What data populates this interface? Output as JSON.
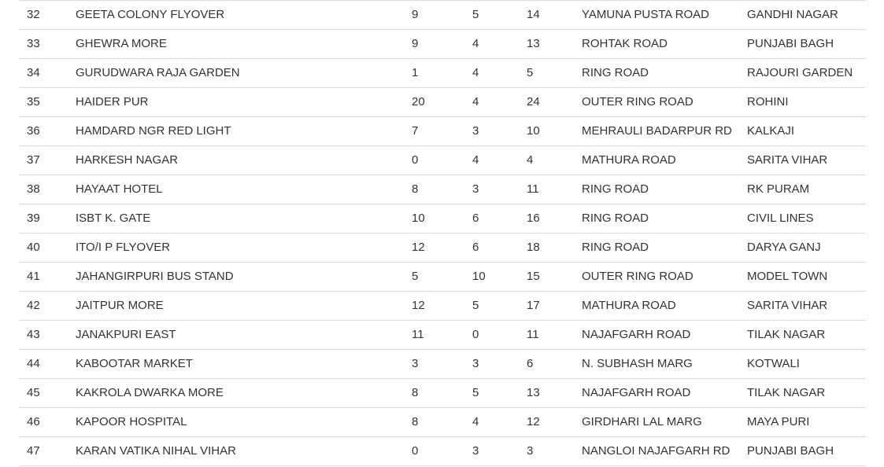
{
  "table": {
    "rows": [
      {
        "no": "32",
        "name": "GEETA COLONY FLYOVER",
        "a": "9",
        "b": "5",
        "c": "14",
        "road": "YAMUNA PUSTA ROAD",
        "area": "GANDHI NAGAR"
      },
      {
        "no": "33",
        "name": "GHEWRA MORE",
        "a": "9",
        "b": "4",
        "c": "13",
        "road": "ROHTAK ROAD",
        "area": "PUNJABI BAGH"
      },
      {
        "no": "34",
        "name": "GURUDWARA RAJA GARDEN",
        "a": "1",
        "b": "4",
        "c": "5",
        "road": "RING ROAD",
        "area": "RAJOURI GARDEN"
      },
      {
        "no": "35",
        "name": "HAIDER PUR",
        "a": "20",
        "b": "4",
        "c": "24",
        "road": "OUTER RING ROAD",
        "area": "ROHINI"
      },
      {
        "no": "36",
        "name": "HAMDARD NGR RED LIGHT",
        "a": "7",
        "b": "3",
        "c": "10",
        "road": "MEHRAULI BADARPUR RD",
        "area": "KALKAJI"
      },
      {
        "no": "37",
        "name": "HARKESH NAGAR",
        "a": "0",
        "b": "4",
        "c": "4",
        "road": "MATHURA ROAD",
        "area": "SARITA VIHAR"
      },
      {
        "no": "38",
        "name": "HAYAAT HOTEL",
        "a": "8",
        "b": "3",
        "c": "11",
        "road": "RING ROAD",
        "area": "RK PURAM"
      },
      {
        "no": "39",
        "name": "ISBT K. GATE",
        "a": "10",
        "b": "6",
        "c": "16",
        "road": "RING ROAD",
        "area": "CIVIL LINES"
      },
      {
        "no": "40",
        "name": "ITO/I P FLYOVER",
        "a": "12",
        "b": "6",
        "c": "18",
        "road": "RING ROAD",
        "area": "DARYA GANJ"
      },
      {
        "no": "41",
        "name": "JAHANGIRPURI BUS STAND",
        "a": "5",
        "b": "10",
        "c": "15",
        "road": "OUTER RING ROAD",
        "area": "MODEL TOWN"
      },
      {
        "no": "42",
        "name": "JAITPUR MORE",
        "a": "12",
        "b": "5",
        "c": "17",
        "road": "MATHURA ROAD",
        "area": "SARITA VIHAR"
      },
      {
        "no": "43",
        "name": "JANAKPURI EAST",
        "a": "11",
        "b": "0",
        "c": "11",
        "road": "NAJAFGARH ROAD",
        "area": "TILAK NAGAR"
      },
      {
        "no": "44",
        "name": "KABOOTAR MARKET",
        "a": "3",
        "b": "3",
        "c": "6",
        "road": "N. SUBHASH MARG",
        "area": "KOTWALI"
      },
      {
        "no": "45",
        "name": "KAKROLA DWARKA MORE",
        "a": "8",
        "b": "5",
        "c": "13",
        "road": "NAJAFGARH ROAD",
        "area": "TILAK NAGAR"
      },
      {
        "no": "46",
        "name": "KAPOOR HOSPITAL",
        "a": "8",
        "b": "4",
        "c": "12",
        "road": "GIRDHARI LAL MARG",
        "area": "MAYA PURI"
      },
      {
        "no": "47",
        "name": "KARAN VATIKA NIHAL VIHAR",
        "a": "0",
        "b": "3",
        "c": "3",
        "road": "NANGLOI NAJAFGARH RD",
        "area": "PUNJABI BAGH"
      }
    ]
  }
}
